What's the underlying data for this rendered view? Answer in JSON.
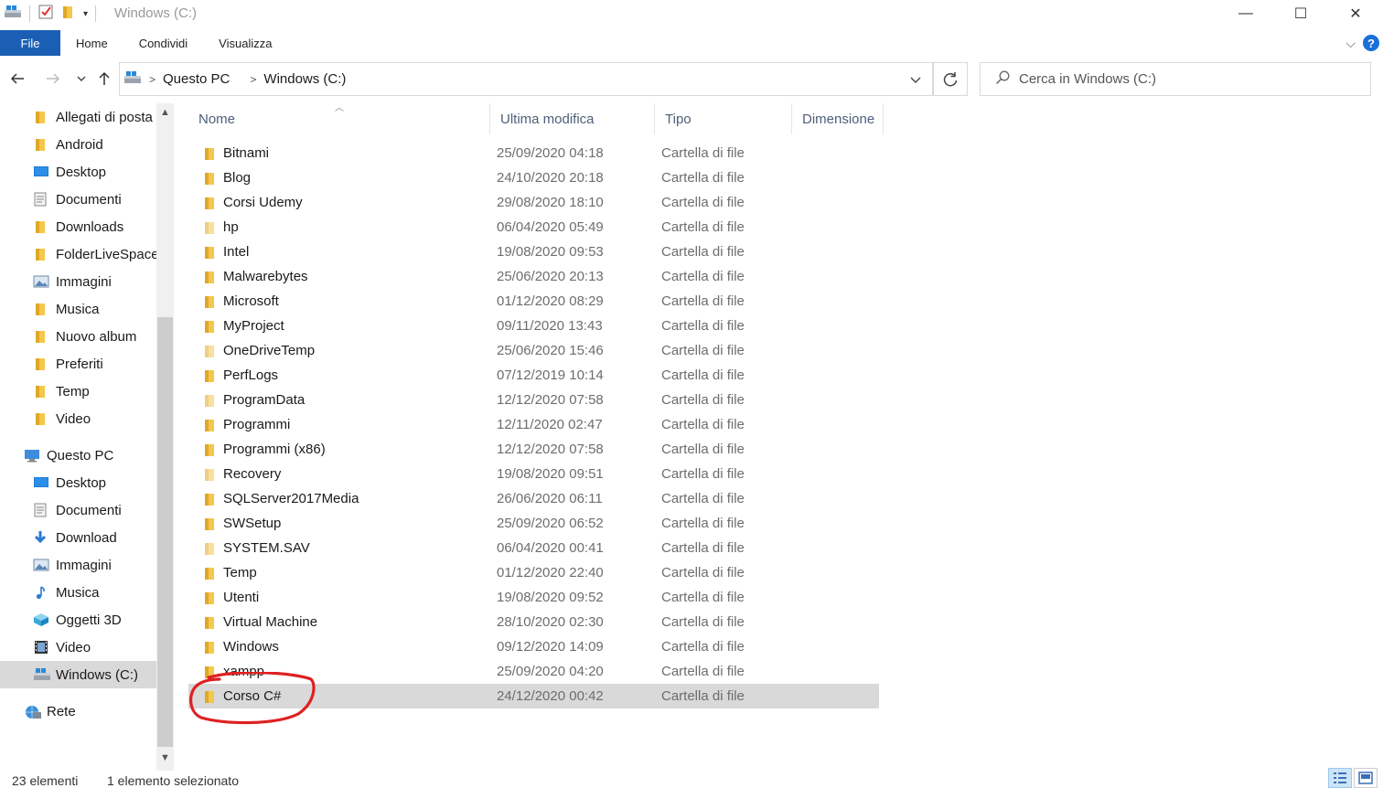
{
  "window": {
    "title": "Windows (C:)",
    "minimize_glyph": "—",
    "maximize_glyph": "☐",
    "close_glyph": "✕"
  },
  "ribbon": {
    "file": "File",
    "tabs": [
      "Home",
      "Condividi",
      "Visualizza"
    ]
  },
  "address": {
    "breadcrumbs": [
      "Questo PC",
      "Windows (C:)"
    ]
  },
  "search": {
    "placeholder": "Cerca in Windows (C:)"
  },
  "sidebar": {
    "items": [
      {
        "label": "Allegati di posta",
        "icon": "folder-icon"
      },
      {
        "label": "Android",
        "icon": "folder-icon"
      },
      {
        "label": "Desktop",
        "icon": "desktop-icon"
      },
      {
        "label": "Documenti",
        "icon": "documents-icon"
      },
      {
        "label": "Downloads",
        "icon": "folder-icon"
      },
      {
        "label": "FolderLiveSpace",
        "icon": "folder-icon"
      },
      {
        "label": "Immagini",
        "icon": "pictures-icon"
      },
      {
        "label": "Musica",
        "icon": "folder-icon"
      },
      {
        "label": "Nuovo album",
        "icon": "folder-icon"
      },
      {
        "label": "Preferiti",
        "icon": "folder-icon"
      },
      {
        "label": "Temp",
        "icon": "folder-icon"
      },
      {
        "label": "Video",
        "icon": "folder-icon"
      },
      {
        "label": "Questo PC",
        "icon": "computer-icon"
      },
      {
        "label": "Desktop",
        "icon": "desktop-icon"
      },
      {
        "label": "Documenti",
        "icon": "documents-icon"
      },
      {
        "label": "Download",
        "icon": "download-icon"
      },
      {
        "label": "Immagini",
        "icon": "pictures-icon"
      },
      {
        "label": "Musica",
        "icon": "music-icon"
      },
      {
        "label": "Oggetti 3D",
        "icon": "objects-3d-icon"
      },
      {
        "label": "Video",
        "icon": "video-icon"
      },
      {
        "label": "Windows (C:)",
        "icon": "drive-icon",
        "selected": true
      },
      {
        "label": "Rete",
        "icon": "network-icon"
      }
    ]
  },
  "columns": {
    "name": "Nome",
    "modified": "Ultima modifica",
    "type": "Tipo",
    "size": "Dimensione"
  },
  "files": [
    {
      "name": "Bitnami",
      "modified": "25/09/2020 04:18",
      "type": "Cartella di file"
    },
    {
      "name": "Blog",
      "modified": "24/10/2020 20:18",
      "type": "Cartella di file"
    },
    {
      "name": "Corsi Udemy",
      "modified": "29/08/2020 18:10",
      "type": "Cartella di file"
    },
    {
      "name": "hp",
      "modified": "06/04/2020 05:49",
      "type": "Cartella di file",
      "hidden": true
    },
    {
      "name": "Intel",
      "modified": "19/08/2020 09:53",
      "type": "Cartella di file"
    },
    {
      "name": "Malwarebytes",
      "modified": "25/06/2020 20:13",
      "type": "Cartella di file"
    },
    {
      "name": "Microsoft",
      "modified": "01/12/2020 08:29",
      "type": "Cartella di file"
    },
    {
      "name": "MyProject",
      "modified": "09/11/2020 13:43",
      "type": "Cartella di file"
    },
    {
      "name": "OneDriveTemp",
      "modified": "25/06/2020 15:46",
      "type": "Cartella di file",
      "hidden": true
    },
    {
      "name": "PerfLogs",
      "modified": "07/12/2019 10:14",
      "type": "Cartella di file"
    },
    {
      "name": "ProgramData",
      "modified": "12/12/2020 07:58",
      "type": "Cartella di file",
      "hidden": true
    },
    {
      "name": "Programmi",
      "modified": "12/11/2020 02:47",
      "type": "Cartella di file"
    },
    {
      "name": "Programmi (x86)",
      "modified": "12/12/2020 07:58",
      "type": "Cartella di file"
    },
    {
      "name": "Recovery",
      "modified": "19/08/2020 09:51",
      "type": "Cartella di file",
      "hidden": true
    },
    {
      "name": "SQLServer2017Media",
      "modified": "26/06/2020 06:11",
      "type": "Cartella di file"
    },
    {
      "name": "SWSetup",
      "modified": "25/09/2020 06:52",
      "type": "Cartella di file"
    },
    {
      "name": "SYSTEM.SAV",
      "modified": "06/04/2020 00:41",
      "type": "Cartella di file",
      "hidden": true
    },
    {
      "name": "Temp",
      "modified": "01/12/2020 22:40",
      "type": "Cartella di file"
    },
    {
      "name": "Utenti",
      "modified": "19/08/2020 09:52",
      "type": "Cartella di file"
    },
    {
      "name": "Virtual Machine",
      "modified": "28/10/2020 02:30",
      "type": "Cartella di file"
    },
    {
      "name": "Windows",
      "modified": "09/12/2020 14:09",
      "type": "Cartella di file"
    },
    {
      "name": "xampp",
      "modified": "25/09/2020 04:20",
      "type": "Cartella di file"
    },
    {
      "name": "Corso C#",
      "modified": "24/12/2020 00:42",
      "type": "Cartella di file",
      "selected": true
    }
  ],
  "status": {
    "count": "23 elementi",
    "selection": "1 elemento selezionato"
  },
  "colors": {
    "file_tab": "#1a5fb4",
    "folder": "#f5c84c",
    "folder_dark": "#e0a829",
    "annotation": "#e02020",
    "selection": "#d9d9d9"
  }
}
